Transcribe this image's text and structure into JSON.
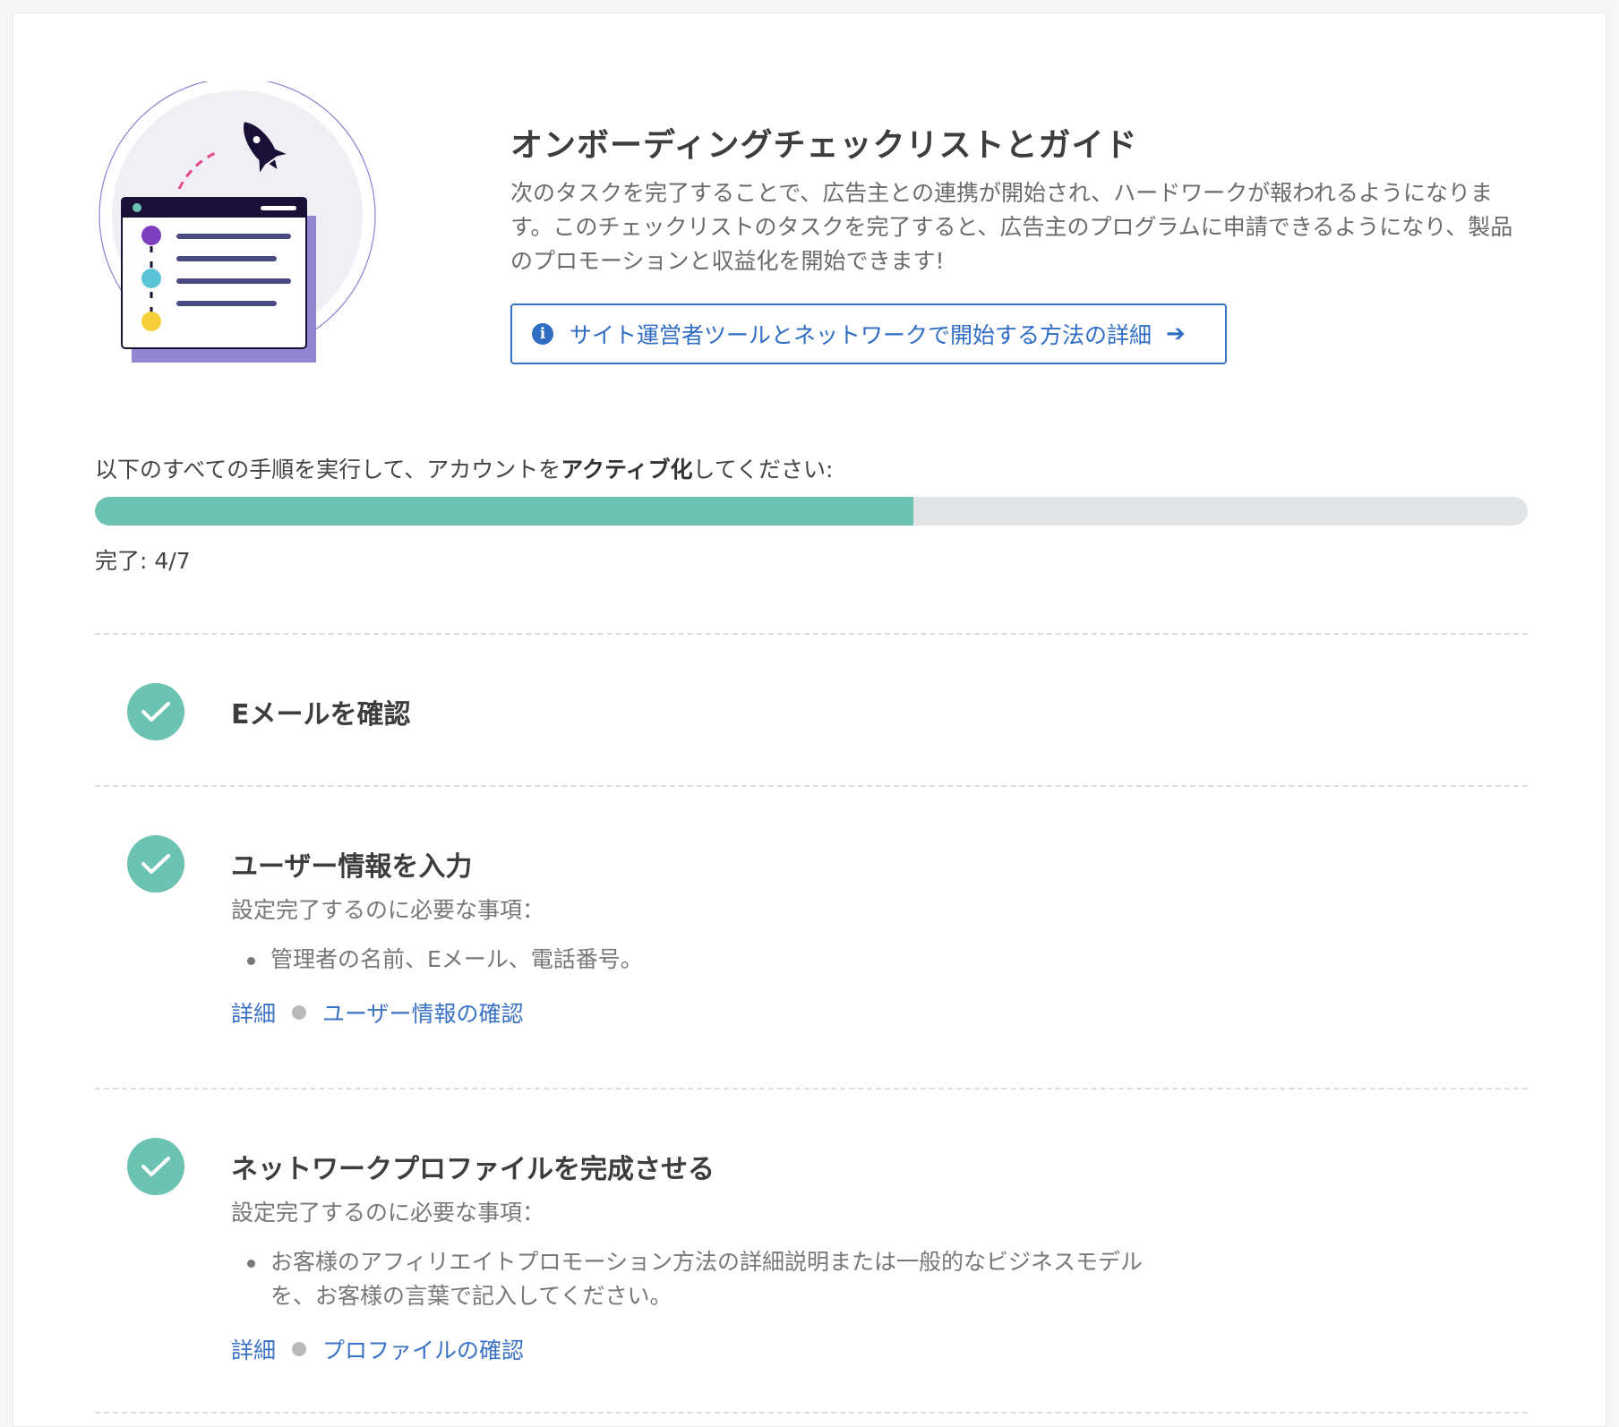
{
  "header": {
    "title": "オンボーディングチェックリストとガイド",
    "description": "次のタスクを完了することで、広告主との連携が開始され、ハードワークが報われるようになります。このチェックリストのタスクを完了すると、広告主のプログラムに申請できるようになり、製品のプロモーションと収益化を開始できます!",
    "guide_button_label": "サイト運営者ツールとネットワークで開始する方法の詳細",
    "guide_button_icon": "info-icon",
    "guide_button_arrow_icon": "arrow-right-icon"
  },
  "progress": {
    "label_prefix": "以下のすべての手順を実行して、アカウントを",
    "label_bold": "アクティブ化",
    "label_suffix": "してください:",
    "completed": 4,
    "total": 7,
    "count_text": "完了: 4/7"
  },
  "tasks": [
    {
      "title": "Eメールを確認",
      "status": "completed",
      "icon": "check-icon"
    },
    {
      "title": "ユーザー情報を入力",
      "status": "completed",
      "icon": "check-icon",
      "requirements_label": "設定完了するのに必要な事項：",
      "requirements": [
        "管理者の名前、Eメール、電話番号。"
      ],
      "details_link": "詳細",
      "action_link": "ユーザー情報の確認"
    },
    {
      "title": "ネットワークプロファイルを完成させる",
      "status": "completed",
      "icon": "check-icon",
      "requirements_label": "設定完了するのに必要な事項：",
      "requirements": [
        "お客様のアフィリエイトプロモーション方法の詳細説明または一般的なビジネスモデルを、お客様の言葉で記入してください。"
      ],
      "details_link": "詳細",
      "action_link": "プロファイルの確認"
    }
  ],
  "colors": {
    "accent_green": "#6cc3b1",
    "link_blue": "#3a72c4",
    "track_gray": "#e1e4e7"
  }
}
